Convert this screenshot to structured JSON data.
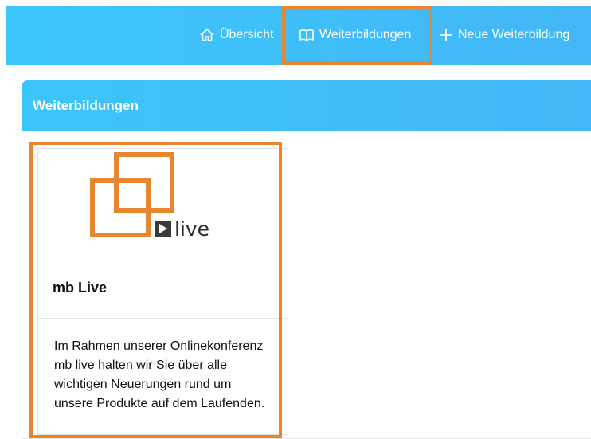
{
  "nav": {
    "overview": "Übersicht",
    "courses": "Weiterbildungen",
    "new_course": "Neue Weiterbildung",
    "highlight_color": "#e8852f",
    "bar_color": "#3fbdf8"
  },
  "panel": {
    "title": "Weiterbildungen"
  },
  "card": {
    "logo_text": "live",
    "logo_color": "#e8852f",
    "title": "mb Live",
    "description": "Im Rahmen unserer Onlinekonferenz mb live halten wir Sie über alle wichtigen Neuerungen rund um unsere Produkte auf dem Laufenden."
  },
  "icons": [
    "home-icon",
    "book-icon",
    "plus-icon",
    "play-icon"
  ]
}
